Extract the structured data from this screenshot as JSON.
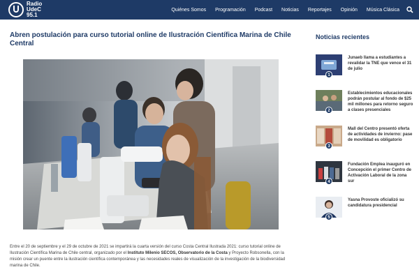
{
  "header": {
    "logo_line1": "Radio",
    "logo_line2": "UdeC",
    "logo_line3": "95.1",
    "nav": [
      "Quiénes Somos",
      "Programación",
      "Podcast",
      "Noticias",
      "Reportajes",
      "Opinión",
      "Música Clásica"
    ]
  },
  "article": {
    "title": "Abren postulación para curso tutorial online de Ilustración Científica Marina de Chile Central",
    "p1_a": "Entre el 20 de septiembre y el 29 de octubre de 2021 se impartirá la cuarta versión del curso Costa Central Ilustrada 2021: curso tutorial online de Ilustración Científica Marina de Chile central, organizado por el ",
    "p1_b": "Instituto Milenio SECOS, Observatorio de la Costa",
    "p1_c": " y Proyecto Robsonella, con la misión crear un puente entre la ilustración científica contemporánea y las necesidades reales de visualización de la investigación de la biodiversidad marina de Chile."
  },
  "sidebar": {
    "title": "Noticias recientes",
    "items": [
      {
        "num": "1",
        "text": "Junaeb llama a estudiantes a revalidar la TNE que vence el 31 de julio"
      },
      {
        "num": "2",
        "text": "Establecimientos educacionales podrán postular al fondo de $25 mil millones para retorno seguro a clases presenciales"
      },
      {
        "num": "3",
        "text": "Mall del Centro presentó oferta de actividades de invierno: pase de movilidad es obligatorio"
      },
      {
        "num": "4",
        "text": "Fundación Emplea inauguró en Concepción el primer Centro de Activación Laboral de la zona sur"
      },
      {
        "num": "5",
        "text": "Yasna Provoste oficializó su candidatura presidencial"
      }
    ]
  },
  "colors": {
    "brand": "#1e3a66"
  }
}
